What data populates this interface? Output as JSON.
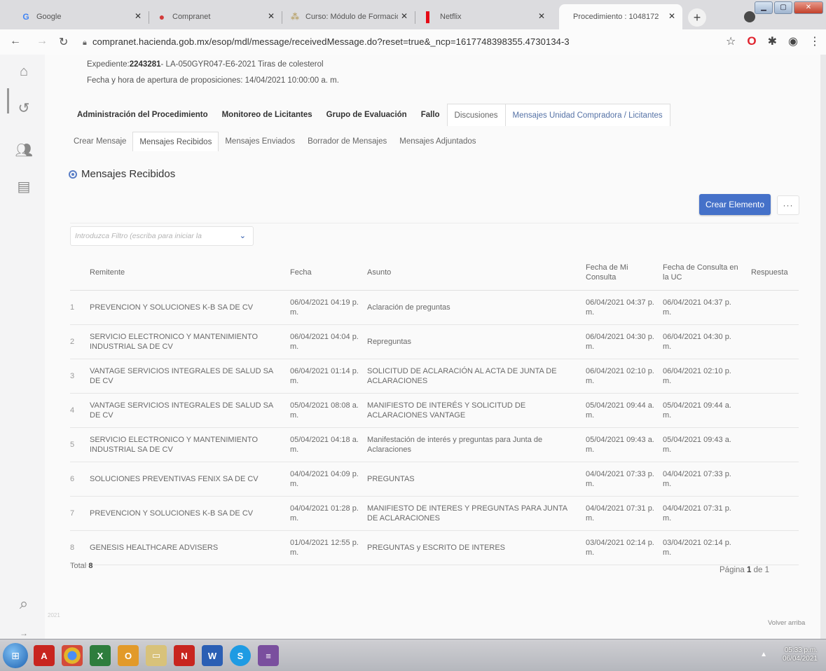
{
  "browser": {
    "tabs": [
      {
        "title": "Google",
        "favicon": "G",
        "color": "#4285f4"
      },
      {
        "title": "Compranet",
        "favicon": "●",
        "color": "#d23b3b"
      },
      {
        "title": "Curso: Módulo de Formació",
        "favicon": "⁂",
        "color": "#b9a36b"
      },
      {
        "title": "Netflix",
        "favicon": "▌",
        "color": "#e50914"
      },
      {
        "title": "Procedimiento : 1048172",
        "favicon": "",
        "color": "#444"
      }
    ],
    "url": "compranet.hacienda.gob.mx/esop/mdl/message/receivedMessage.do?reset=true&_ncp=1617748398355.4730134-3"
  },
  "procedure": {
    "expediente_label": "Expediente:",
    "expediente_number": "2243281",
    "expediente_rest": "- LA-050GYR047-E6-2021 Tiras de colesterol",
    "apertura": "Fecha y hora de apertura de proposiciones: 14/04/2021 10:00:00 a. m."
  },
  "main_tabs": [
    "Administración del Procedimiento",
    "Monitoreo de Licitantes",
    "Grupo de Evaluación",
    "Fallo",
    "Discusiones",
    "Mensajes Unidad Compradora / Licitantes"
  ],
  "sub_tabs": [
    "Crear Mensaje",
    "Mensajes Recibidos",
    "Mensajes Enviados",
    "Borrador de Mensajes",
    "Mensajes Adjuntados"
  ],
  "section_title": "Mensajes Recibidos",
  "create_button": "Crear Elemento",
  "more_button": "···",
  "filter_placeholder": "Introduzca Filtro (escriba para iniciar la",
  "table": {
    "headers": {
      "remitente": "Remitente",
      "fecha": "Fecha",
      "asunto": "Asunto",
      "fecha_mi_consulta": "Fecha de Mi Consulta",
      "fecha_consulta_uc": "Fecha de Consulta en la UC",
      "respuesta": "Respuesta"
    },
    "rows": [
      {
        "n": "1",
        "remitente": "PREVENCION Y SOLUCIONES K-B SA DE CV",
        "fecha": "06/04/2021 04:19 p. m.",
        "asunto": "Aclaración de preguntas",
        "fmc": "06/04/2021 04:37 p. m.",
        "fcu": "06/04/2021 04:37 p. m.",
        "resp": ""
      },
      {
        "n": "2",
        "remitente": "SERVICIO ELECTRONICO Y MANTENIMIENTO INDUSTRIAL SA DE CV",
        "fecha": "06/04/2021 04:04 p. m.",
        "asunto": "Repreguntas",
        "fmc": "06/04/2021 04:30 p. m.",
        "fcu": "06/04/2021 04:30 p. m.",
        "resp": ""
      },
      {
        "n": "3",
        "remitente": "VANTAGE SERVICIOS INTEGRALES DE SALUD SA DE CV",
        "fecha": "06/04/2021 01:14 p. m.",
        "asunto": "SOLICITUD DE ACLARACIÓN AL ACTA DE JUNTA DE ACLARACIONES",
        "fmc": "06/04/2021 02:10 p. m.",
        "fcu": "06/04/2021 02:10 p. m.",
        "resp": ""
      },
      {
        "n": "4",
        "remitente": "VANTAGE SERVICIOS INTEGRALES DE SALUD SA DE CV",
        "fecha": "05/04/2021 08:08 a. m.",
        "asunto": "MANIFIESTO DE INTERÉS Y SOLICITUD DE ACLARACIONES VANTAGE",
        "fmc": "05/04/2021 09:44 a. m.",
        "fcu": "05/04/2021 09:44 a. m.",
        "resp": ""
      },
      {
        "n": "5",
        "remitente": "SERVICIO ELECTRONICO Y MANTENIMIENTO INDUSTRIAL SA DE CV",
        "fecha": "05/04/2021 04:18 a. m.",
        "asunto": "Manifestación de interés y preguntas para Junta de Aclaraciones",
        "fmc": "05/04/2021 09:43 a. m.",
        "fcu": "05/04/2021 09:43 a. m.",
        "resp": ""
      },
      {
        "n": "6",
        "remitente": "SOLUCIONES PREVENTIVAS FENIX SA DE CV",
        "fecha": "04/04/2021 04:09 p. m.",
        "asunto": "PREGUNTAS",
        "fmc": "04/04/2021 07:33 p. m.",
        "fcu": "04/04/2021 07:33 p. m.",
        "resp": ""
      },
      {
        "n": "7",
        "remitente": "PREVENCION Y SOLUCIONES K-B SA DE CV",
        "fecha": "04/04/2021 01:28 p. m.",
        "asunto": "MANIFIESTO DE INTERES Y PREGUNTAS PARA JUNTA DE ACLARACIONES",
        "fmc": "04/04/2021 07:31 p. m.",
        "fcu": "04/04/2021 07:31 p. m.",
        "resp": ""
      },
      {
        "n": "8",
        "remitente": "GENESIS HEALTHCARE ADVISERS",
        "fecha": "01/04/2021 12:55 p. m.",
        "asunto": "PREGUNTAS y ESCRITO DE INTERES",
        "fmc": "03/04/2021 02:14 p. m.",
        "fcu": "03/04/2021 02:14 p. m.",
        "resp": ""
      }
    ]
  },
  "total_label": "Total",
  "total_value": "8",
  "page_label": "Página",
  "page_current": "1",
  "page_of": "de 1",
  "footer_year": "2021",
  "volver_arriba": "Volver arriba",
  "taskbar": {
    "time": "05:33 p.m.",
    "date": "06/04/2021"
  },
  "colors": {
    "accent": "#4571c9",
    "link": "#5572a6"
  }
}
